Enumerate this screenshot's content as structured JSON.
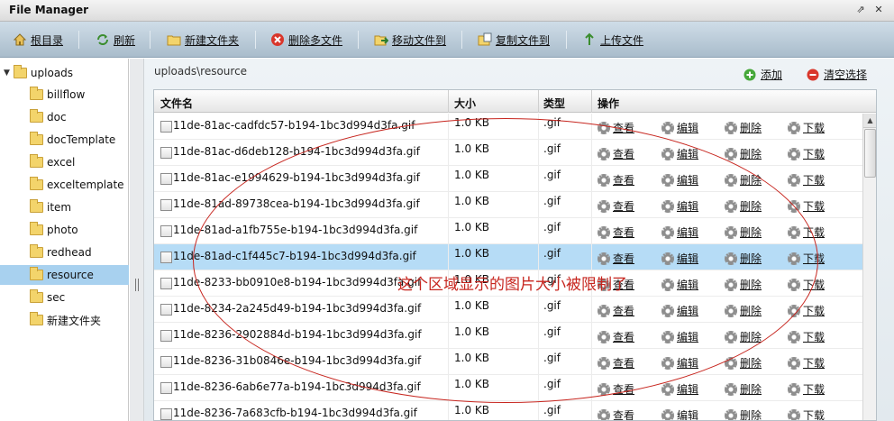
{
  "window": {
    "title": "File Manager",
    "controls": [
      {
        "icon": "restore-icon",
        "glyph": "⇗"
      },
      {
        "icon": "close-icon",
        "glyph": "✕"
      }
    ]
  },
  "toolbar": {
    "items": [
      {
        "label": "根目录",
        "icon": "home-icon"
      },
      {
        "label": "刷新",
        "icon": "refresh-icon"
      },
      {
        "label": "新建文件夹",
        "icon": "new-folder-icon"
      },
      {
        "label": "删除多文件",
        "icon": "delete-icon"
      },
      {
        "label": "移动文件到",
        "icon": "move-icon"
      },
      {
        "label": "复制文件到",
        "icon": "copy-icon"
      },
      {
        "label": "上传文件",
        "icon": "upload-icon"
      }
    ]
  },
  "tree": {
    "root": "uploads",
    "children": [
      "billflow",
      "doc",
      "docTemplate",
      "excel",
      "exceltemplate",
      "item",
      "photo",
      "redhead",
      "resource",
      "sec",
      "新建文件夹"
    ],
    "selected": "resource"
  },
  "main": {
    "path": "uploads\\resource",
    "add_label": "添加",
    "clear_label": "清空选择"
  },
  "grid": {
    "columns": [
      "文件名",
      "大小",
      "类型",
      "操作"
    ],
    "actions": [
      "查看",
      "编辑",
      "删除",
      "下载"
    ],
    "selected_row": 5,
    "rows": [
      {
        "name": "11de-81ac-cadfdc57-b194-1bc3d994d3fa.gif",
        "size": "1.0 KB",
        "type": ".gif"
      },
      {
        "name": "11de-81ac-d6deb128-b194-1bc3d994d3fa.gif",
        "size": "1.0 KB",
        "type": ".gif"
      },
      {
        "name": "11de-81ac-e1994629-b194-1bc3d994d3fa.gif",
        "size": "1.0 KB",
        "type": ".gif"
      },
      {
        "name": "11de-81ad-89738cea-b194-1bc3d994d3fa.gif",
        "size": "1.0 KB",
        "type": ".gif"
      },
      {
        "name": "11de-81ad-a1fb755e-b194-1bc3d994d3fa.gif",
        "size": "1.0 KB",
        "type": ".gif"
      },
      {
        "name": "11de-81ad-c1f445c7-b194-1bc3d994d3fa.gif",
        "size": "1.0 KB",
        "type": ".gif"
      },
      {
        "name": "11de-8233-bb0910e8-b194-1bc3d994d3fa.gif",
        "size": "1.0 KB",
        "type": ".gif"
      },
      {
        "name": "11de-8234-2a245d49-b194-1bc3d994d3fa.gif",
        "size": "1.0 KB",
        "type": ".gif"
      },
      {
        "name": "11de-8236-2902884d-b194-1bc3d994d3fa.gif",
        "size": "1.0 KB",
        "type": ".gif"
      },
      {
        "name": "11de-8236-31b0846e-b194-1bc3d994d3fa.gif",
        "size": "1.0 KB",
        "type": ".gif"
      },
      {
        "name": "11de-8236-6ab6e77a-b194-1bc3d994d3fa.gif",
        "size": "1.0 KB",
        "type": ".gif"
      },
      {
        "name": "11de-8236-7a683cfb-b194-1bc3d994d3fa.gif",
        "size": "1.0 KB",
        "type": ".gif"
      }
    ]
  },
  "annotation": {
    "text": "这个区域显示的图片大小被限制了",
    "color": "#c7261f"
  }
}
